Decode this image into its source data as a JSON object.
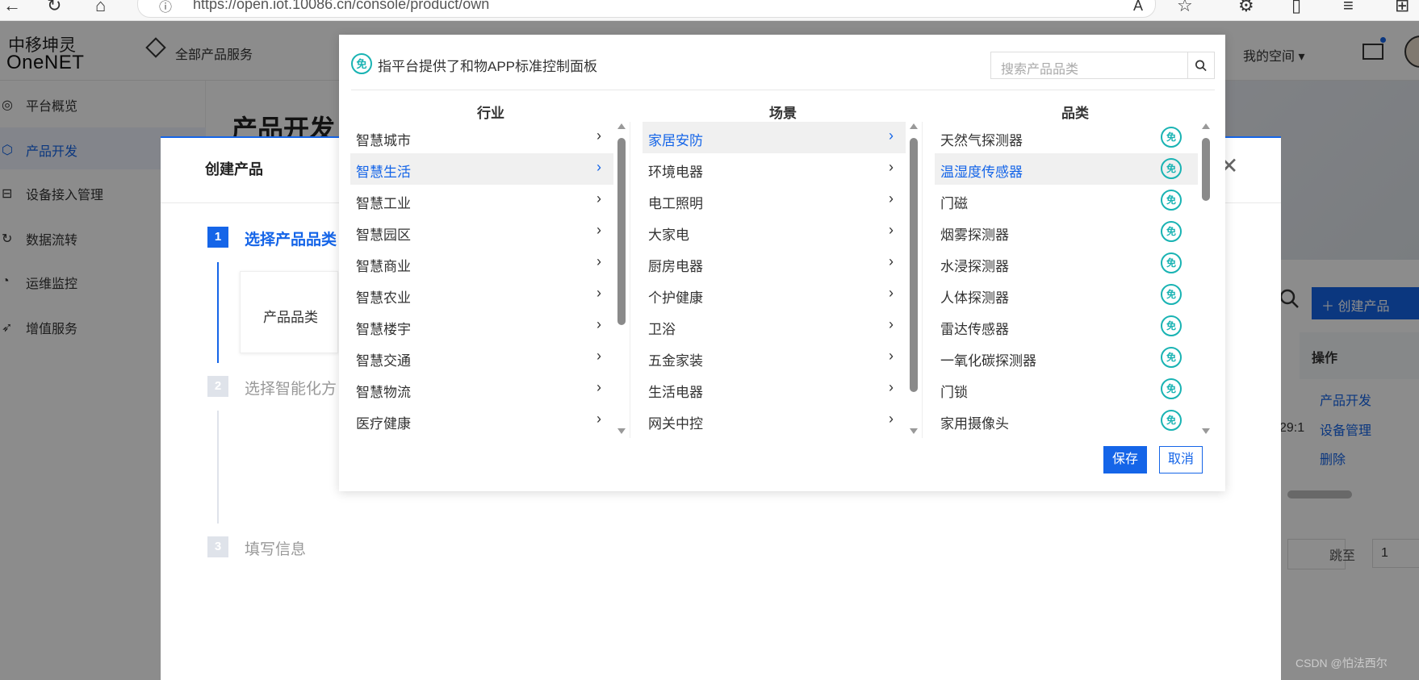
{
  "browser": {
    "url": "https://open.iot.10086.cn/console/product/own"
  },
  "header": {
    "logo_cn": "中移坤灵",
    "logo_en": "OneNET",
    "all_products": "全部产品服务",
    "my_space": "我的空间 ▾"
  },
  "sidebar": {
    "items": [
      {
        "label": "平台概览",
        "icon": "overview-icon"
      },
      {
        "label": "产品开发",
        "icon": "product-dev-icon",
        "active": true
      },
      {
        "label": "设备接入管理",
        "icon": "device-access-icon"
      },
      {
        "label": "数据流转",
        "icon": "data-flow-icon"
      },
      {
        "label": "运维监控",
        "icon": "monitor-icon"
      },
      {
        "label": "增值服务",
        "icon": "value-added-icon"
      }
    ]
  },
  "main": {
    "heading": "产品开发",
    "create_button": "＋ 创建产品",
    "ops_header": "操作",
    "ops_links": [
      "产品开发",
      "设备管理",
      "删除"
    ],
    "time_fragment": "29:1",
    "jump_label": "跳至",
    "jump_value": "1"
  },
  "create_modal": {
    "title": "创建产品",
    "steps": [
      {
        "num": "1",
        "label": "选择产品品类",
        "active": true
      },
      {
        "num": "2",
        "label": "选择智能化方",
        "active": false
      },
      {
        "num": "3",
        "label": "填写信息",
        "active": false
      }
    ],
    "category_label": "产品品类"
  },
  "picker": {
    "note": "指平台提供了和物APP标准控制面板",
    "badge": "免",
    "search_placeholder": "搜索产品品类",
    "columns": {
      "industry": {
        "header": "行业",
        "items": [
          "智慧城市",
          "智慧生活",
          "智慧工业",
          "智慧园区",
          "智慧商业",
          "智慧农业",
          "智慧楼宇",
          "智慧交通",
          "智慧物流",
          "医疗健康"
        ],
        "selected_index": 1
      },
      "scene": {
        "header": "场景",
        "items": [
          "家居安防",
          "环境电器",
          "电工照明",
          "大家电",
          "厨房电器",
          "个护健康",
          "卫浴",
          "五金家装",
          "生活电器",
          "网关中控"
        ],
        "selected_index": 0
      },
      "category": {
        "header": "品类",
        "items": [
          "天然气探测器",
          "温湿度传感器",
          "门磁",
          "烟雾探测器",
          "水浸探测器",
          "人体探测器",
          "雷达传感器",
          "一氧化碳探测器",
          "门锁",
          "家用摄像头"
        ],
        "selected_index": 1
      }
    },
    "save": "保存",
    "cancel": "取消"
  },
  "watermark": "CSDN @怕法西尔",
  "colors": {
    "accent": "#1565e8",
    "badge": "#19b3b3"
  }
}
